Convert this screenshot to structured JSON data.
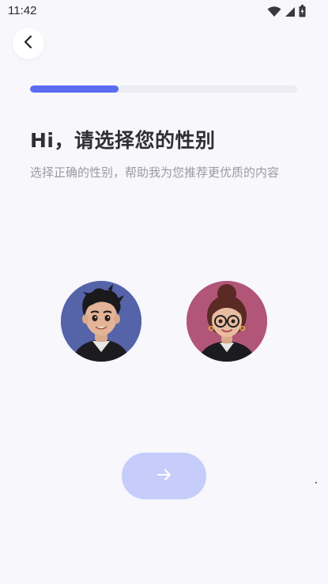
{
  "status_bar": {
    "time": "11:42",
    "icons": [
      "wifi-icon",
      "cellular-signal-icon",
      "battery-icon"
    ]
  },
  "header": {
    "back_icon": "chevron-left-icon"
  },
  "progress": {
    "fraction": 0.33
  },
  "main": {
    "title": "Hi，请选择您的性别",
    "subtitle": "选择正确的性别，帮助我为您推荐更优质的内容"
  },
  "gender_options": [
    {
      "id": "male",
      "background": "#5563a8"
    },
    {
      "id": "female",
      "background": "#b25678"
    }
  ],
  "footer": {
    "next_icon": "arrow-right-icon",
    "button_color": "#c6cdfb"
  },
  "colors": {
    "accent": "#5b6cf2",
    "background": "#f7f7fc",
    "track": "#ececf3"
  }
}
